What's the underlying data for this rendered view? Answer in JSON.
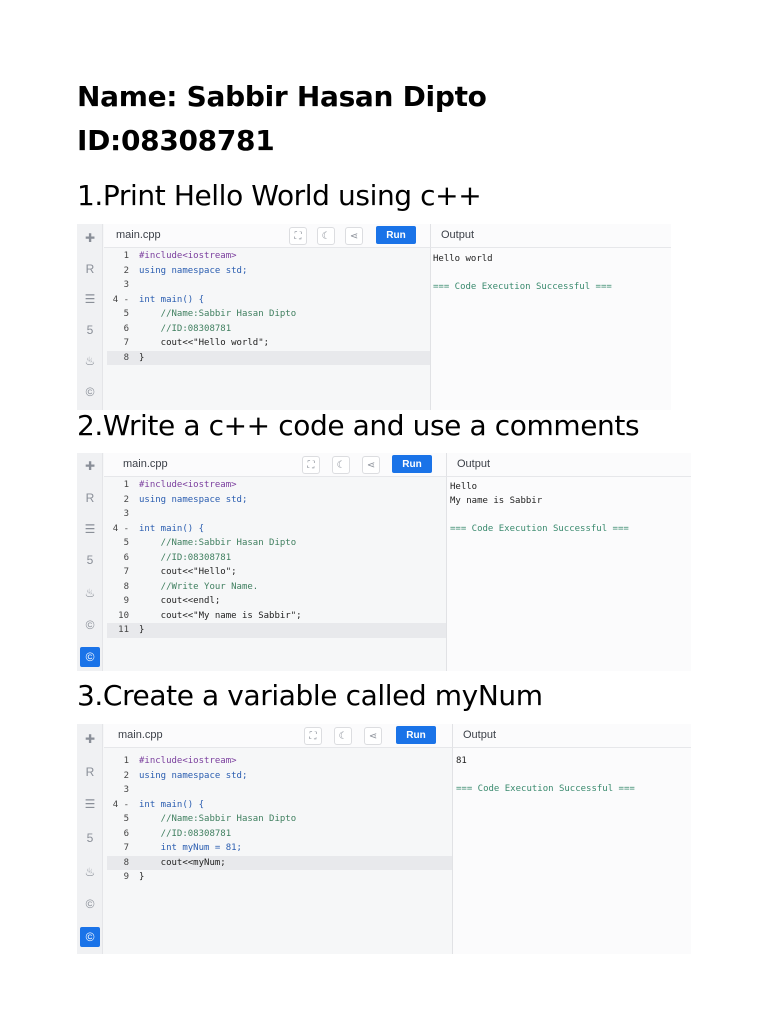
{
  "header": {
    "name": "Name: Sabbir Hasan Dipto",
    "id": "ID:08308781"
  },
  "tasks": [
    {
      "title": "1.Print Hello World using c++",
      "file": "main.cpp",
      "run_label": "Run",
      "output_title": "Output",
      "code": [
        {
          "n": "1",
          "text": "#include<iostream>",
          "cls": "pp"
        },
        {
          "n": "2",
          "text": "using namespace std;",
          "cls": "kw"
        },
        {
          "n": "3",
          "text": "",
          "cls": "plain"
        },
        {
          "n": "4 -",
          "text": "int main() {",
          "cls": "kw"
        },
        {
          "n": "5",
          "text": "    //Name:Sabbir Hasan Dipto",
          "cls": "cm"
        },
        {
          "n": "6",
          "text": "    //ID:08308781",
          "cls": "cm"
        },
        {
          "n": "7",
          "text": "    cout<<\"Hello world\";",
          "cls": "plain"
        },
        {
          "n": "8",
          "text": "}",
          "cls": "plain"
        }
      ],
      "output": [
        "Hello world",
        "",
        "=== Code Execution Successful ==="
      ]
    },
    {
      "title": "2.Write a c++ code and use a  comments",
      "file": "main.cpp",
      "run_label": "Run",
      "output_title": "Output",
      "code": [
        {
          "n": "1",
          "text": "#include<iostream>",
          "cls": "pp"
        },
        {
          "n": "2",
          "text": "using namespace std;",
          "cls": "kw"
        },
        {
          "n": "3",
          "text": "",
          "cls": "plain"
        },
        {
          "n": "4 -",
          "text": "int main() {",
          "cls": "kw"
        },
        {
          "n": "5",
          "text": "    //Name:Sabbir Hasan Dipto",
          "cls": "cm"
        },
        {
          "n": "6",
          "text": "    //ID:08308781",
          "cls": "cm"
        },
        {
          "n": "7",
          "text": "    cout<<\"Hello\";",
          "cls": "plain"
        },
        {
          "n": "8",
          "text": "    //Write Your Name.",
          "cls": "cm"
        },
        {
          "n": "9",
          "text": "    cout<<endl;",
          "cls": "plain"
        },
        {
          "n": "10",
          "text": "    cout<<\"My name is Sabbir\";",
          "cls": "plain"
        },
        {
          "n": "11",
          "text": "}",
          "cls": "plain"
        }
      ],
      "output": [
        "Hello",
        "My name is Sabbir",
        "",
        "=== Code Execution Successful ==="
      ]
    },
    {
      "title": "3.Create a variable called myNum",
      "file": "main.cpp",
      "run_label": "Run",
      "output_title": "Output",
      "code": [
        {
          "n": "1",
          "text": "#include<iostream>",
          "cls": "pp"
        },
        {
          "n": "2",
          "text": "using namespace std;",
          "cls": "kw"
        },
        {
          "n": "3",
          "text": "",
          "cls": "plain"
        },
        {
          "n": "4 -",
          "text": "int main() {",
          "cls": "kw"
        },
        {
          "n": "5",
          "text": "    //Name:Sabbir Hasan Dipto",
          "cls": "cm"
        },
        {
          "n": "6",
          "text": "    //ID:08308781",
          "cls": "cm"
        },
        {
          "n": "7",
          "text": "    int myNum = 81;",
          "cls": "kw"
        },
        {
          "n": "8",
          "text": "    cout<<myNum;",
          "cls": "plain"
        },
        {
          "n": "9",
          "text": "}",
          "cls": "plain"
        }
      ],
      "output": [
        "81",
        "",
        "=== Code Execution Successful ==="
      ]
    }
  ],
  "colors": {
    "accent": "#1a73e8",
    "success": "#3a8a6e"
  },
  "sidebar_icons": [
    "cpp-icon",
    "r-icon",
    "sql-icon",
    "html-icon",
    "java-icon",
    "c-icon",
    "c-active-icon"
  ]
}
